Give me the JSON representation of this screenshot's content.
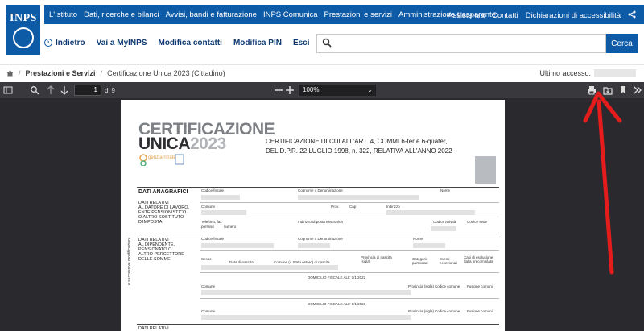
{
  "brand": {
    "logo_text": "INPS"
  },
  "top_nav": {
    "left": [
      "L'Istituto",
      "Dati, ricerche e bilanci",
      "Avvisi, bandi e fatturazione",
      "INPS Comunica",
      "Prestazioni e servizi",
      "Amministrazione trasparente"
    ],
    "right": [
      "Assistenza",
      "Contatti",
      "Dichiarazioni di accessibilità"
    ]
  },
  "secondary_nav": {
    "back": "Indietro",
    "items": [
      "Vai a MyINPS",
      "Modifica contatti",
      "Modifica PIN",
      "Esci"
    ]
  },
  "search": {
    "placeholder": "",
    "button": "Cerca"
  },
  "breadcrumb": {
    "home_icon": "home-icon",
    "items": [
      "Prestazioni e Servizi",
      "Certificazione Unica 2023 (Cittadino)"
    ]
  },
  "last_access": {
    "label": "Ultimo accesso:"
  },
  "pdf_toolbar": {
    "page": "1",
    "of": "di 9",
    "zoom": "100%"
  },
  "document": {
    "title_line1": "CERTIFICAZIONE",
    "title_line2a": "UNICA",
    "title_line2b": "2023",
    "agency": "genzia ntrate",
    "heading_lines": [
      "CERTIFICAZIONE DI CUI ALL'ART. 4, COMMI 6-ter e 6-quater,",
      "DEL D.P.R. 22 LUGLIO 1998, n. 322, RELATIVA ALL'ANNO 2022"
    ],
    "sections": {
      "dati_anagrafici": "DATI ANAGRAFICI",
      "datore": [
        "DATI RELATIVI",
        "AL DATORE DI LAVORO,",
        "ENTE PENSIONISTICO",
        "O ALTRO SOSTITUTO",
        "D'IMPOSTA"
      ],
      "dipendente": [
        "DATI RELATIVI",
        "AL DIPENDENTE,",
        "PENSIONATO O",
        "ALTRO PERCETTORE",
        "DELLE SOMME"
      ],
      "ultimo": [
        "DATI RELATIVI"
      ]
    },
    "fields": {
      "codice_fiscale": "Codice fiscale",
      "cognome": "Cognome o Denominazione",
      "nome": "Nome",
      "comune": "Comune",
      "prov": "Prov.",
      "cap": "Cap",
      "indirizzo": "Indirizzo",
      "telefono": "Telefono, fax",
      "prefisso": "prefisso",
      "numero": "numero",
      "email": "Indirizzo di posta elettronica",
      "codice_attivita": "Codice attività",
      "codice_sede": "Codice sede",
      "sesso": "Sesso",
      "data_nascita": "Data di nascita",
      "comune_nascita": "Comune (o Stato estero) di nascita",
      "provincia": "Provincia di nascita (sigla)",
      "categorie": "Categorie particolari",
      "eventi": "Eventi eccezionali",
      "casi": "Casi di esclusione dalla precompilata",
      "domicilio1": "DOMICILIO FISCALE ALL' 1/1/2022",
      "domicilio2": "DOMICILIO FISCALE ALL' 1/1/2023",
      "provincia_sigla": "Provincia (sigla)",
      "codice_comune": "Codice comune",
      "fusione": "Fusione comuni"
    },
    "side_text": "e successive modificazioni"
  }
}
